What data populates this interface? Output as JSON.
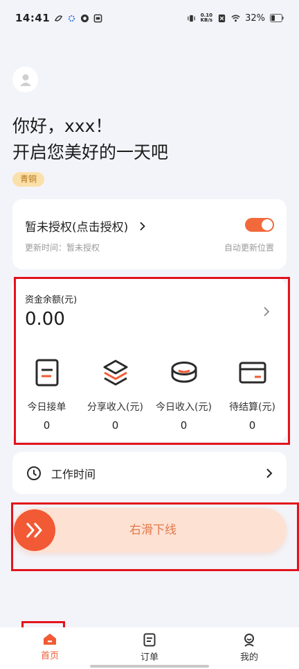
{
  "status_bar": {
    "time": "14:41",
    "net_speed_value": "0.10",
    "net_speed_unit": "KB/s",
    "battery": "32%"
  },
  "greeting": {
    "line1": "你好，xxx！",
    "line2": "开启您美好的一天吧"
  },
  "level_badge": "青铜",
  "auth": {
    "title": "暂未授权(点击授权)",
    "subtitle": "更新时间：暂未授权",
    "auto_update": "自动更新位置",
    "toggle_on": true
  },
  "balance": {
    "label": "资金余额(元)",
    "value": "0.00",
    "stats": [
      {
        "label": "今日接单",
        "value": "0",
        "icon": "order-doc-icon"
      },
      {
        "label": "分享收入(元)",
        "value": "0",
        "icon": "layers-icon"
      },
      {
        "label": "今日收入(元)",
        "value": "0",
        "icon": "coins-icon"
      },
      {
        "label": "待结算(元)",
        "value": "0",
        "icon": "card-icon"
      }
    ]
  },
  "worktime": {
    "label": "工作时间"
  },
  "slider": {
    "label": "右滑下线"
  },
  "bottom_nav": [
    {
      "label": "首页",
      "icon": "home-icon",
      "active": true
    },
    {
      "label": "订单",
      "icon": "order-icon",
      "active": false
    },
    {
      "label": "我的",
      "icon": "profile-icon",
      "active": false
    }
  ],
  "colors": {
    "accent": "#f15a35",
    "highlight": "#e3121c",
    "badge_bg": "#fbe0a9",
    "slider_bg": "#fde1d3"
  }
}
